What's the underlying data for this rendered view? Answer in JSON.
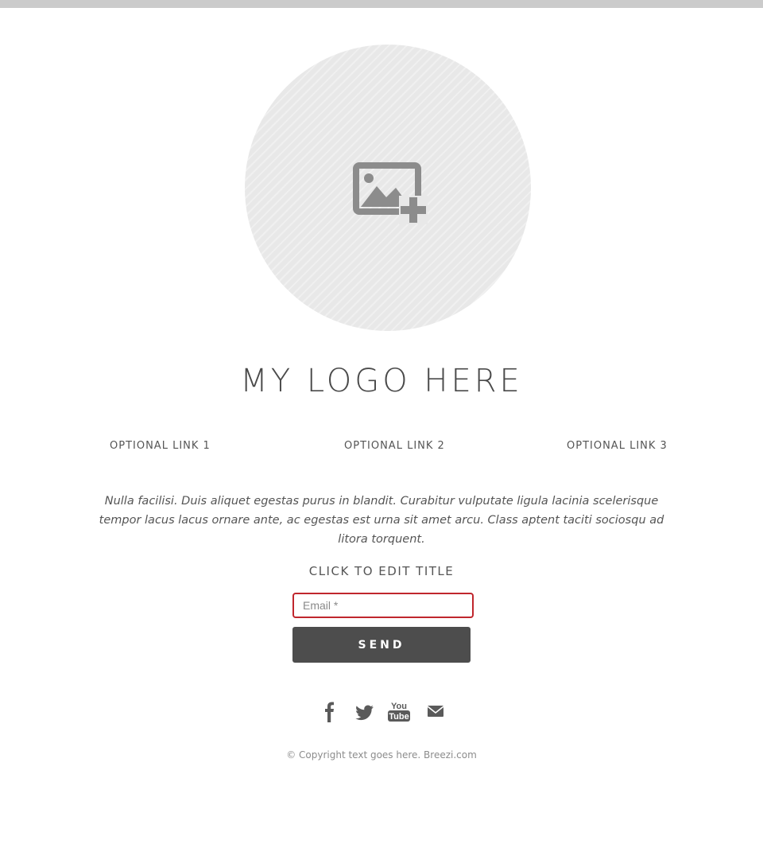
{
  "logo": {
    "image_icon": "add-image-icon",
    "text": "MY LOGO HERE"
  },
  "nav": {
    "links": [
      {
        "label": "OPTIONAL LINK 1"
      },
      {
        "label": "OPTIONAL LINK 2"
      },
      {
        "label": "OPTIONAL LINK 3"
      }
    ]
  },
  "intro": {
    "text": "Nulla facilisi. Duis aliquet egestas purus in blandit.  Curabitur vulputate ligula lacinia scelerisque tempor lacus lacus ornare ante, ac egestas est urna sit amet arcu. Class aptent taciti sociosqu ad litora torquent."
  },
  "form": {
    "title": "CLICK TO EDIT TITLE",
    "email_placeholder": "Email *",
    "email_value": "",
    "send_label": "SEND",
    "error_border_color": "#c0262d",
    "button_color": "#4d4d4d"
  },
  "social": {
    "icons": [
      "facebook-icon",
      "twitter-icon",
      "youtube-icon",
      "email-icon"
    ],
    "youtube_text": [
      "You",
      "Tube"
    ]
  },
  "footer": {
    "copyright": "© Copyright text goes here. Breezi.com"
  }
}
